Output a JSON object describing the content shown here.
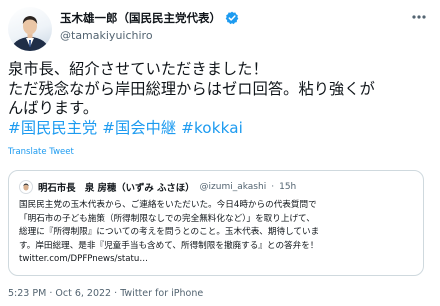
{
  "author": {
    "display_name": "玉木雄一郎（国民民主党代表）",
    "handle": "@tamakiyuichiro"
  },
  "tweet": {
    "lines": [
      "泉市長、紹介させていただきました！",
      "ただ残念ながら岸田総理からはゼロ回答。粘り強くが",
      "んばります。"
    ],
    "hashtags": [
      "#国民民主党",
      "#国会中継",
      "#kokkai"
    ],
    "translate_label": "Translate Tweet"
  },
  "quoted_tweet": {
    "display_name": "明石市長　泉 房穂（いずみ ふさほ）",
    "handle": "@izumi_akashi",
    "separator": "·",
    "time": "15h",
    "lines": [
      "国民民主党の玉木代表から、ご連絡をいただいた。今日4時からの代表質問で",
      "「明石市の子ども施策（所得制限なしでの完全無料化など）」を取り上げて、",
      "総理に『所得制限』についての考えを問うとのこと。玉木代表、期待していま",
      "す。岸田総理、是非『児童手当も含めて、所得制限を撤廃する』との答弁を！",
      "twitter.com/DPFPnews/statu…"
    ]
  },
  "meta": {
    "time": "5:23 PM",
    "dot1": "·",
    "date": "Oct 6, 2022",
    "dot2": "·",
    "source": "Twitter for iPhone"
  },
  "colors": {
    "link": "#1d9bf0",
    "secondary_text": "#536471",
    "border": "#cfd9de"
  },
  "icons": {
    "verified": "verified-badge-icon",
    "more": "more-options-icon"
  }
}
